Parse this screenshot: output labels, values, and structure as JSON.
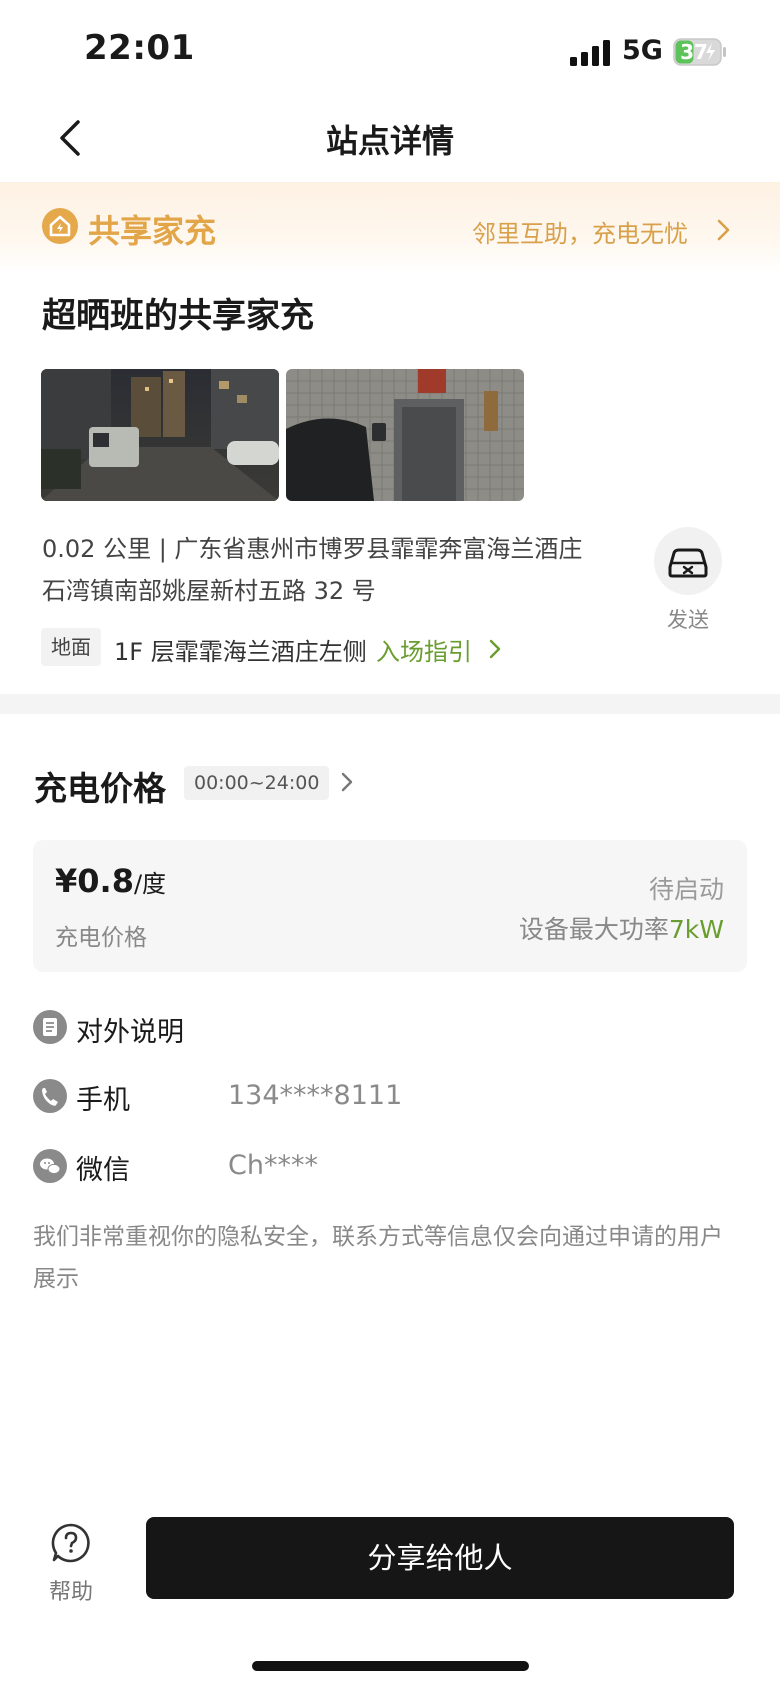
{
  "status_bar": {
    "time": "22:01",
    "network": "5G",
    "battery": "37"
  },
  "nav": {
    "title": "站点详情"
  },
  "banner": {
    "brand": "共享家充",
    "slogan": "邻里互助，充电无忧",
    "brand_color": "#e2a548"
  },
  "station": {
    "name": "超晒班的共享家充",
    "address_line1": "0.02 公里 | 广东省惠州市博罗县霏霏奔富海兰酒庄",
    "address_line2": "石湾镇南部姚屋新村五路 32 号",
    "send_label": "发送",
    "floor_tag": "地面",
    "floor_text": "1F 层霏霏海兰酒庄左侧",
    "guide_link": "入场指引"
  },
  "price": {
    "section_title": "充电价格",
    "time_range": "00:00~24:00",
    "amount": "¥0.8",
    "unit": "/度",
    "label": "充电价格",
    "status": "待启动",
    "power_label": "设备最大功率",
    "power_value": "7kW",
    "accent_color": "#6a9d2f"
  },
  "info": {
    "description_label": "对外说明",
    "phone_label": "手机",
    "phone_value": "134****8111",
    "wechat_label": "微信",
    "wechat_value": "Ch****",
    "privacy_note": "我们非常重视你的隐私安全，联系方式等信息仅会向通过申请的用户展示"
  },
  "bottom": {
    "help_label": "帮助",
    "share_button": "分享给他人"
  }
}
